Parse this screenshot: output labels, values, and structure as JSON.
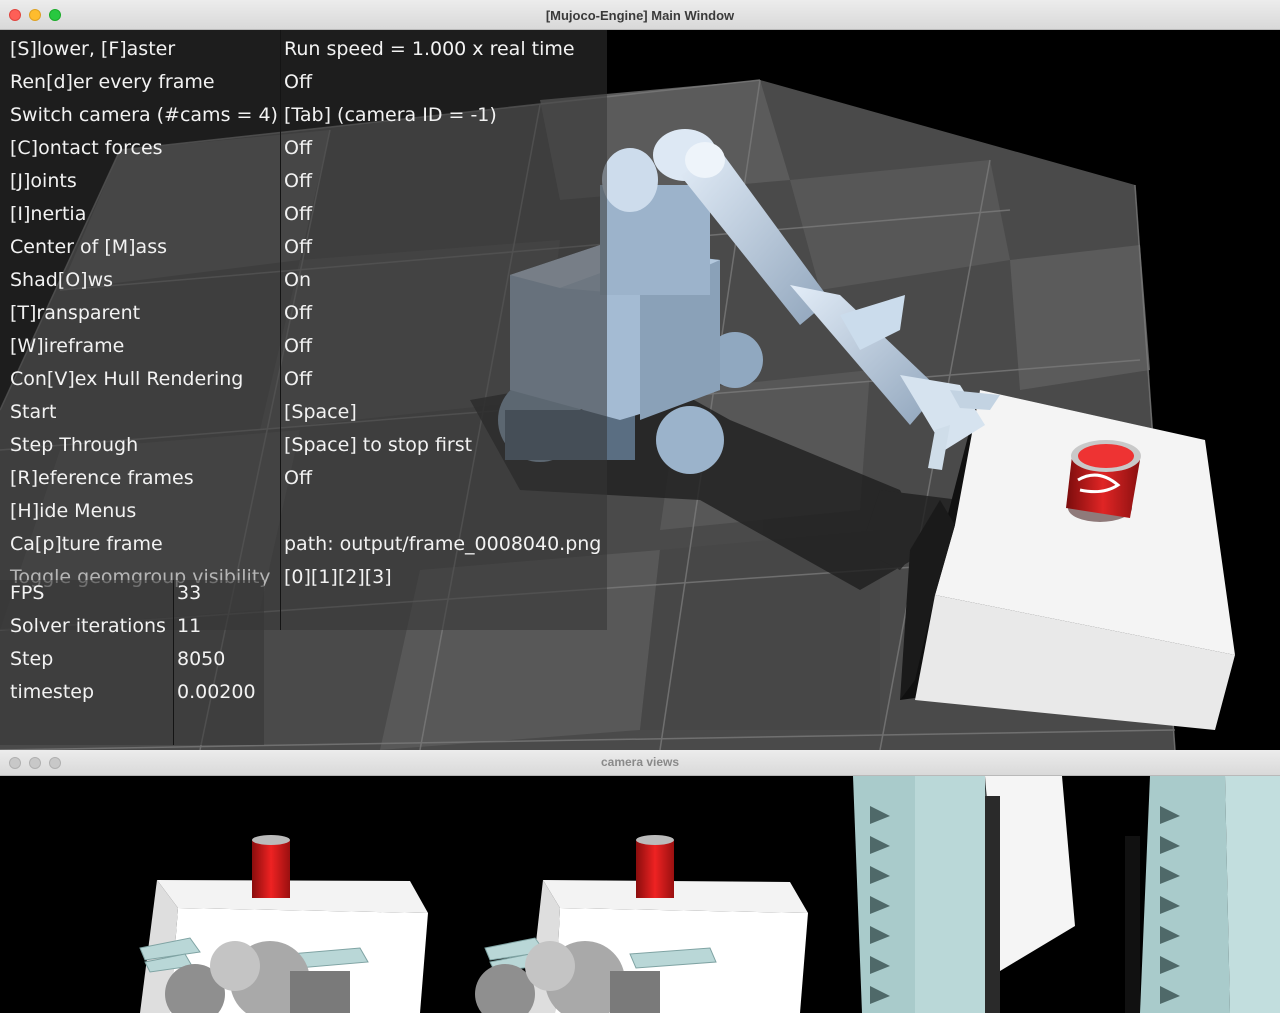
{
  "main_window": {
    "title": "[Mujoco-Engine] Main Window"
  },
  "menu": {
    "items": [
      {
        "label": "[S]lower, [F]aster",
        "value": "Run speed = 1.000 x real time"
      },
      {
        "label": "Ren[d]er every frame",
        "value": "Off"
      },
      {
        "label": "Switch camera (#cams = 4)",
        "value": "[Tab] (camera ID = -1)"
      },
      {
        "label": "[C]ontact forces",
        "value": "Off"
      },
      {
        "label": "[J]oints",
        "value": "Off"
      },
      {
        "label": "[I]nertia",
        "value": "Off"
      },
      {
        "label": "Center of [M]ass",
        "value": "Off"
      },
      {
        "label": "Shad[O]ws",
        "value": "On"
      },
      {
        "label": "[T]ransparent",
        "value": "Off"
      },
      {
        "label": "[W]ireframe",
        "value": "Off"
      },
      {
        "label": "Con[V]ex Hull Rendering",
        "value": "Off"
      },
      {
        "label": "Start",
        "value": "[Space]"
      },
      {
        "label": "Step Through",
        "value": "[Space] to stop first"
      },
      {
        "label": "[R]eference frames",
        "value": "Off"
      },
      {
        "label": "[H]ide Menus",
        "value": ""
      },
      {
        "label": "Ca[p]ture frame",
        "value": "path: output/frame_0008040.png"
      },
      {
        "label": "Toggle geomgroup visibility",
        "value": "[0][1][2][3]"
      }
    ]
  },
  "stats": {
    "items": [
      {
        "label": "FPS",
        "value": "33"
      },
      {
        "label": "Solver iterations",
        "value": "11"
      },
      {
        "label": "Step",
        "value": "8050"
      },
      {
        "label": "timestep",
        "value": "0.00200"
      }
    ]
  },
  "camera_window": {
    "title": "camera views"
  },
  "colors": {
    "robot": "#b9cde2",
    "can": "#cc1a1a",
    "gripper": "#a6cccc",
    "table": "#ffffff",
    "floor_dark": "#3c3c3c",
    "floor_light": "#575757"
  }
}
